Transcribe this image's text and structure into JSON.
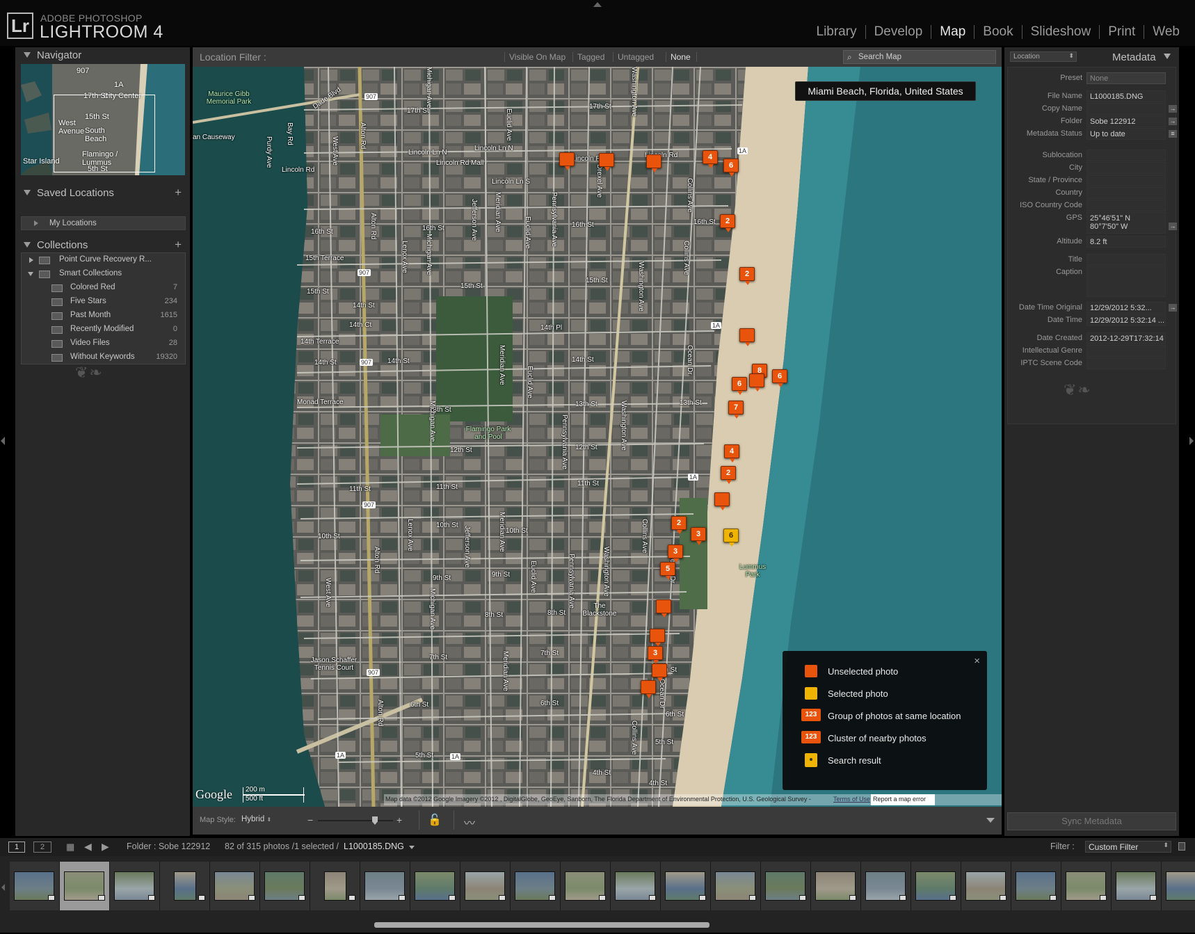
{
  "app": {
    "logo_text": "Lr",
    "vendor": "ADOBE PHOTOSHOP",
    "name": "LIGHTROOM 4",
    "modules": [
      "Library",
      "Develop",
      "Map",
      "Book",
      "Slideshow",
      "Print",
      "Web"
    ],
    "active_module": "Map"
  },
  "navigator": {
    "title": "Navigator",
    "labels": {
      "city_center": "City Center",
      "west_avenue": "West Avenue",
      "south_beach": "South Beach",
      "flamingo": "Flamingo / Lummus",
      "star_island": "Star Island",
      "st15": "15th St",
      "st17": "17th St",
      "st5": "5th St",
      "r907": "907",
      "r1a": "1A"
    }
  },
  "saved_locations": {
    "title": "Saved Locations",
    "items": [
      "My Locations"
    ]
  },
  "collections": {
    "title": "Collections",
    "items": [
      {
        "name": "Point Curve Recovery R...",
        "count": ""
      },
      {
        "name": "Smart Collections",
        "count": ""
      }
    ],
    "smart": [
      {
        "name": "Colored Red",
        "count": "7"
      },
      {
        "name": "Five Stars",
        "count": "234"
      },
      {
        "name": "Past Month",
        "count": "1615"
      },
      {
        "name": "Recently Modified",
        "count": "0"
      },
      {
        "name": "Video Files",
        "count": "28"
      },
      {
        "name": "Without Keywords",
        "count": "19320"
      }
    ]
  },
  "location_filter": {
    "label": "Location Filter :",
    "options": [
      "Visible On Map",
      "Tagged",
      "Untagged",
      "None"
    ],
    "active": "None",
    "search_placeholder": "Search Map"
  },
  "map": {
    "location_title": "Miami Beach, Florida, United States",
    "streets": {
      "s17": "17th St",
      "lincoln": "Lincoln Rd",
      "lincolnln": "Lincoln Ln N",
      "lincolnrdmall": "Lincoln Rd Mall",
      "lincolnlns": "Lincoln Ln S",
      "s16": "16th St",
      "s15terr": "15th Terrace",
      "s15": "15th St",
      "s14": "14th St",
      "s14pl": "14th Pl",
      "s14terr": "14th Terrace",
      "s14ct": "14th Ct",
      "s13": "13th St",
      "monad": "Monad Terrace",
      "s12": "12th St",
      "s11": "11th St",
      "s10": "10th St",
      "s10terr": "10th St",
      "s9": "9th St",
      "s8": "8th St",
      "s7": "7th St",
      "s6": "6th St",
      "s5": "5th St",
      "s4": "4th St",
      "alton": "Alton Rd",
      "westave": "West Ave",
      "lenox": "Lenox Ave",
      "michigan": "Michigan Ave",
      "meridian": "Meridian Ave",
      "jefferson": "Jefferson Ave",
      "euclid": "Euclid Ave",
      "pennsylvania": "Pennsylvania Ave",
      "drexel": "Drexel Ave",
      "washington": "Washington Ave",
      "collins": "Collins Ave",
      "ocean": "Ocean Dr",
      "dade": "Dade Blvd",
      "purdy": "Purdy Ave",
      "bay": "Bay Rd",
      "causeway": "an Causeway",
      "r907": "907",
      "r1a": "1A",
      "maurice": "Maurice Gibb Memorial Park",
      "flamingo": "Flamingo Park and Pool",
      "lummus": "Lummus Park",
      "jason": "Jason Schaffer Tennis Court",
      "blackstone": "The Blackstone"
    },
    "pins": [
      {
        "label": "",
        "selected": false
      },
      {
        "label": "",
        "selected": false
      },
      {
        "label": "",
        "selected": false
      },
      {
        "label": "4",
        "selected": false
      },
      {
        "label": "6",
        "selected": false
      },
      {
        "label": "2",
        "selected": false
      },
      {
        "label": "2",
        "selected": false
      },
      {
        "label": "",
        "selected": false
      },
      {
        "label": "8",
        "selected": false
      },
      {
        "label": "6",
        "selected": false
      },
      {
        "label": "6",
        "selected": false
      },
      {
        "label": "",
        "selected": false
      },
      {
        "label": "7",
        "selected": false
      },
      {
        "label": "4",
        "selected": false
      },
      {
        "label": "2",
        "selected": false
      },
      {
        "label": "",
        "selected": false
      },
      {
        "label": "2",
        "selected": false
      },
      {
        "label": "3",
        "selected": false
      },
      {
        "label": "6",
        "selected": true
      },
      {
        "label": "3",
        "selected": false
      },
      {
        "label": "5",
        "selected": false
      },
      {
        "label": "",
        "selected": false
      },
      {
        "label": "",
        "selected": false
      },
      {
        "label": "3",
        "selected": false
      },
      {
        "label": "",
        "selected": false
      },
      {
        "label": "",
        "selected": false
      }
    ],
    "legend": [
      {
        "kind": "unselected",
        "badge": "",
        "text": "Unselected photo"
      },
      {
        "kind": "selected",
        "badge": "",
        "text": "Selected photo"
      },
      {
        "kind": "group",
        "badge": "123",
        "text": "Group of photos at same location"
      },
      {
        "kind": "cluster",
        "badge": "123",
        "text": "Cluster of nearby photos"
      },
      {
        "kind": "search",
        "badge": "",
        "text": "Search result"
      }
    ],
    "legend_close": "×",
    "google": "Google",
    "scale_m": "200 m",
    "scale_ft": "500 ft",
    "attribution": "Map data ©2012 Google Imagery ©2012 , DigitalGlobe, GeoEye, Sanborn, The Florida Department of Environmental Protection, U.S. Geological Survey -",
    "terms": "Terms of Use",
    "report": "Report a map error"
  },
  "map_toolbar": {
    "style_label": "Map Style:",
    "style_value": "Hybrid",
    "zoom_level": 0.82
  },
  "metadata": {
    "preset_dropdown": "Location",
    "title": "Metadata",
    "preset_label": "Preset",
    "preset_value": "None",
    "fields": [
      {
        "k": "File Name",
        "v": "L1000185.DNG",
        "btn": ""
      },
      {
        "k": "Copy Name",
        "v": "",
        "btn": "→"
      },
      {
        "k": "Folder",
        "v": "Sobe 122912",
        "btn": "→"
      },
      {
        "k": "Metadata Status",
        "v": "Up to date",
        "btn": "≡"
      }
    ],
    "location_fields": [
      {
        "k": "Sublocation",
        "v": ""
      },
      {
        "k": "City",
        "v": ""
      },
      {
        "k": "State / Province",
        "v": ""
      },
      {
        "k": "Country",
        "v": ""
      },
      {
        "k": "ISO Country Code",
        "v": ""
      }
    ],
    "gps_label": "GPS",
    "gps_line1": "25°46'51\" N",
    "gps_line2": "80°7'50\" W",
    "altitude_label": "Altitude",
    "altitude_value": "8.2 ft",
    "title_label": "Title",
    "caption_label": "Caption",
    "dto_label": "Date Time Original",
    "dto_value": "12/29/2012 5:32...",
    "dt_label": "Date Time",
    "dt_value": "12/29/2012 5:32:14 ...",
    "created_label": "Date Created",
    "created_value": "2012-12-29T17:32:14",
    "genre_label": "Intellectual Genre",
    "scene_label": "IPTC Scene Code",
    "sync_button": "Sync Metadata"
  },
  "filmstrip_bar": {
    "page1": "1",
    "page2": "2",
    "folder": "Folder : Sobe 122912",
    "count": "82 of 315 photos /1 selected /",
    "filename": "L1000185.DNG",
    "filter_label": "Filter :",
    "filter_value": "Custom Filter"
  },
  "colors": {
    "pin": "#e8540c",
    "pin_selected": "#f0b400",
    "panel": "#282828",
    "bg": "#000000"
  }
}
